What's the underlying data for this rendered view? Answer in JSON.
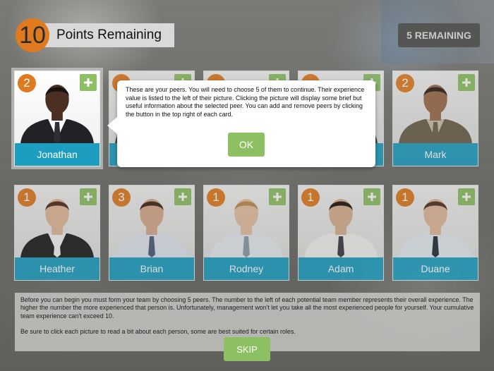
{
  "header": {
    "points_value": "10",
    "points_label": "Points Remaining",
    "remaining_button": "5 REMAINING"
  },
  "cards": [
    {
      "name": "Jonathan",
      "experience": "2",
      "skin": "#4a2f22",
      "hair": "#1a1210",
      "shirt": "#ffffff",
      "jacket": "#222226",
      "tie": "#2e2e36"
    },
    {
      "name": "",
      "experience": "",
      "skin": "#c9a184",
      "hair": "#3a2a1e",
      "shirt": "#ffffff",
      "jacket": "#3a3a3a",
      "tie": "#444"
    },
    {
      "name": "",
      "experience": "",
      "skin": "#d6b094",
      "hair": "#5a3d25",
      "shirt": "#ffffff",
      "jacket": "#3a3a3a",
      "tie": "#444"
    },
    {
      "name": "",
      "experience": "",
      "skin": "#d0a888",
      "hair": "#2b1e14",
      "shirt": "#ffffff",
      "jacket": "#3a3a3a",
      "tie": "#444"
    },
    {
      "name": "Mark",
      "experience": "2",
      "skin": "#9a6a4a",
      "hair": "#2a1a12",
      "shirt": "#c9c0a8",
      "jacket": "#6b5e4a",
      "tie": "#6b5e4a"
    },
    {
      "name": "Heather",
      "experience": "1",
      "skin": "#e3b89a",
      "hair": "#4a2a18",
      "shirt": "#f4f4f4",
      "jacket": "#1c1c1e",
      "tie": "#f4f4f4"
    },
    {
      "name": "Brian",
      "experience": "3",
      "skin": "#d8a98c",
      "hair": "#3a2516",
      "shirt": "#dfe6ee",
      "jacket": "#dfe6ee",
      "tie": "#4a5a7a"
    },
    {
      "name": "Rodney",
      "experience": "1",
      "skin": "#e6bfa2",
      "hair": "#b8884e",
      "shirt": "#e8ecf0",
      "jacket": "#e8ecf0",
      "tie": "#8a9aa8"
    },
    {
      "name": "Adam",
      "experience": "1",
      "skin": "#d8b08e",
      "hair": "#1a1410",
      "shirt": "#f2f2f2",
      "jacket": "#f2f2f2",
      "tie": "#3a3a44"
    },
    {
      "name": "Duane",
      "experience": "1",
      "skin": "#e2b89a",
      "hair": "#4a3020",
      "shirt": "#e4eaf0",
      "jacket": "#e4eaf0",
      "tie": "#1e2a3a"
    }
  ],
  "tooltip": {
    "text": "These are your peers. You will need to choose 5 of them to continue. Their experience value is listed to the left of their picture. Clicking the picture will display some brief but useful information about the selected peer. You can add and remove peers by clicking the button in the top right of each card.",
    "ok_label": "OK"
  },
  "info": {
    "paragraph1": "Before you can begin you must form your team by choosing 5 peers. The number to the left of each potential team member represents their overall experience. The higher the number the more experienced that person is. Unfortunately, management won't let you take all the most experienced people for yourself. Your cumulative team experience can't exceed 10.",
    "paragraph2": "Be sure to click each picture to read a bit about each person, some are best suited for certain roles."
  },
  "skip_label": "SKIP",
  "colors": {
    "accent_orange": "#e07a1f",
    "name_bar_blue": "#1d9ec1",
    "button_green": "#8cc063"
  },
  "icons": {
    "add": "plus-icon"
  }
}
